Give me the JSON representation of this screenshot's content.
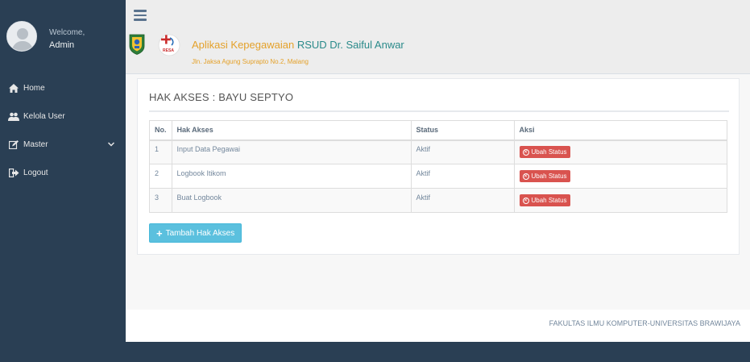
{
  "sidebar": {
    "welcome": "Welcome,",
    "user": "Admin",
    "items": [
      {
        "label": "Home",
        "icon": "home-icon"
      },
      {
        "label": "Kelola User",
        "icon": "users-icon"
      },
      {
        "label": "Master",
        "icon": "edit-icon"
      },
      {
        "label": "Logout",
        "icon": "sign-out-icon"
      }
    ]
  },
  "header": {
    "title_part1": "Aplikasi Kepegawaian",
    "title_part2": "RSUD Dr. Saiful Anwar",
    "address": "Jln. Jaksa Agung Suprapto No.2, Malang",
    "logo_text": "RESA"
  },
  "panel": {
    "title": "HAK AKSES : BAYU SEPTYO",
    "columns": [
      "No.",
      "Hak Akses",
      "Status",
      "Aksi"
    ],
    "rows": [
      {
        "no": "1",
        "hak": "Input Data Pegawai",
        "status": "Aktif",
        "aksi": "Ubah Status"
      },
      {
        "no": "2",
        "hak": "Logbook Itikom",
        "status": "Aktif",
        "aksi": "Ubah Status"
      },
      {
        "no": "3",
        "hak": "Buat Logbook",
        "status": "Aktif",
        "aksi": "Ubah Status"
      }
    ],
    "add_button": "Tambah Hak Akses"
  },
  "footer": {
    "text": "FAKULTAS ILMU KOMPUTER-UNIVERSITAS BRAWIJAYA"
  },
  "colors": {
    "sidebar": "#2a3f54",
    "title_orange": "#e4a12a",
    "title_teal": "#2a8a8a",
    "danger": "#d9534f",
    "info": "#5bc0de"
  }
}
